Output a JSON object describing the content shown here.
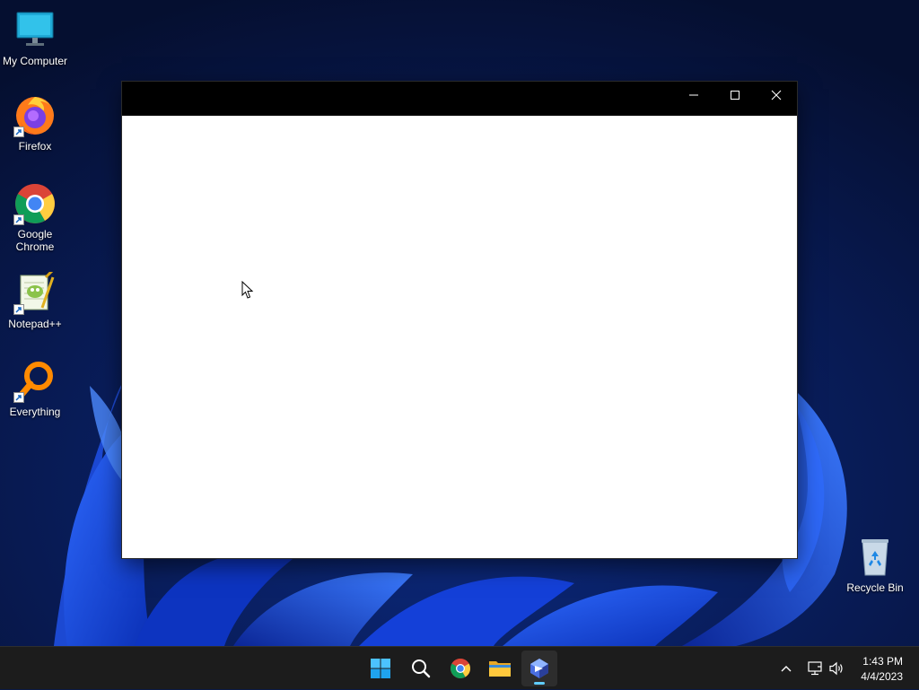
{
  "desktop": {
    "icons": [
      {
        "label": "My Computer",
        "icon": "monitor-icon"
      },
      {
        "label": "Firefox",
        "icon": "firefox-icon"
      },
      {
        "label": "Google Chrome",
        "icon": "chrome-icon"
      },
      {
        "label": "Notepad++",
        "icon": "notepad-plus-plus-icon"
      },
      {
        "label": "Everything",
        "icon": "everything-search-icon"
      },
      {
        "label": "Recycle Bin",
        "icon": "recycle-bin-icon"
      }
    ]
  },
  "window": {
    "title": "",
    "controls": [
      "minimize-icon",
      "maximize-icon",
      "close-icon"
    ],
    "titlebar_color": "#000000",
    "content_color": "#ffffff"
  },
  "taskbar": {
    "apps": [
      {
        "name": "Start",
        "icon": "windows-start-icon"
      },
      {
        "name": "Search",
        "icon": "search-icon"
      },
      {
        "name": "Google Chrome",
        "icon": "chrome-icon"
      },
      {
        "name": "File Explorer",
        "icon": "folder-icon"
      },
      {
        "name": "Active app",
        "icon": "app-icon",
        "active": true
      }
    ],
    "tray": {
      "icons": [
        "chevron-up-icon",
        "network-icon",
        "volume-icon"
      ],
      "time": "1:43 PM",
      "date": "4/4/2023"
    },
    "accent": "#60cdff"
  }
}
